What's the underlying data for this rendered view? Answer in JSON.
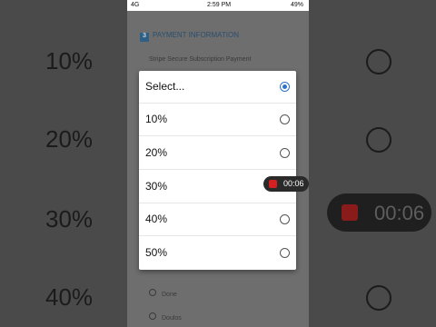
{
  "status_bar": {
    "network": "4G",
    "time": "2:59 PM",
    "battery": "49%"
  },
  "background": {
    "page_header_num": "3",
    "page_header_text": "PAYMENT INFORMATION",
    "page_line": "Stripe Secure Subscription Payment",
    "page_foot_1": "Done",
    "page_foot_2": "Doulos",
    "zoom_labels": [
      "10%",
      "20%",
      "30%",
      "40%"
    ],
    "zoom_rec_time": "00:06"
  },
  "dialog": {
    "options": [
      {
        "label": "Select...",
        "selected": true
      },
      {
        "label": "10%",
        "selected": false
      },
      {
        "label": "20%",
        "selected": false
      },
      {
        "label": "30%",
        "selected": false
      },
      {
        "label": "40%",
        "selected": false
      },
      {
        "label": "50%",
        "selected": false
      }
    ]
  },
  "recorder": {
    "time": "00:06",
    "color": "#d42020"
  }
}
